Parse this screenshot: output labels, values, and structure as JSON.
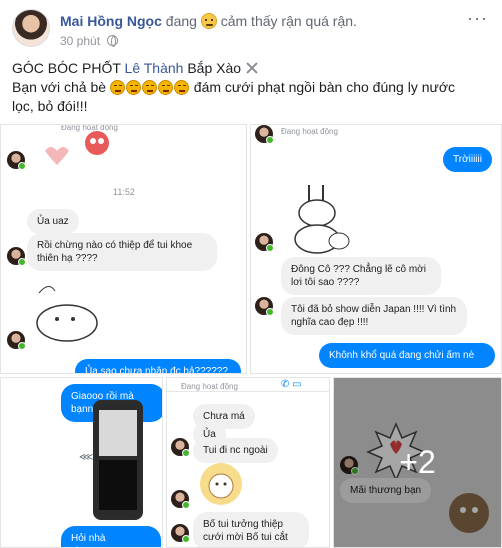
{
  "post": {
    "author": "Mai Hồng Ngọc",
    "feeling_prefix": "đang",
    "feeling_text": "cảm thấy rận quá rận.",
    "time": "30 phút",
    "more": "···",
    "line1_prefix": "GÓC BÓC PHỐT",
    "tagged": "Lê Thành",
    "line1_suffix": "Bắp Xào",
    "line2_prefix": "Bạn với chả bè",
    "line2_suffix": "đám cưới phạt ngồi bàn cho đúng ly nước",
    "line3": "lọc, bỏ đói!!!"
  },
  "photos": {
    "more_count": "+2",
    "a": {
      "status": "Đang hoạt động",
      "time": "11:52",
      "msg1": "Ủa uaz",
      "msg2": "Rồi chừng nào có thiệp để tui khoe thiên hạ ????",
      "msg3": "Ủa sao chưa nhận đc hả??????"
    },
    "b": {
      "status": "Đang hoạt động",
      "msg1": "Trờiiiiii",
      "msg2": "Đông Cô ??? Chẳng lẽ cô mời lơi tôi sao ????",
      "msg3": "Tôi đã bỏ show diễn Japan !!!! Vì tình nghĩa cao đẹp !!!!",
      "msg4": "Khônh khổ quá đang chửi ấm nè"
    },
    "c": {
      "msg1": "Giaooo rồi mà bạnnnnnnnn",
      "msg2": "Hỏi nhà chưa????????"
    },
    "d": {
      "status": "Đang hoạt động",
      "msg1": "Chưa má",
      "msg2": "Ủa",
      "msg3": "Tui đi nc ngoài",
      "msg4": "Bố tui tưởng thiệp cưới mời Bố tui cắt"
    },
    "e": {
      "msg1": "Mãi thương bạn"
    }
  }
}
